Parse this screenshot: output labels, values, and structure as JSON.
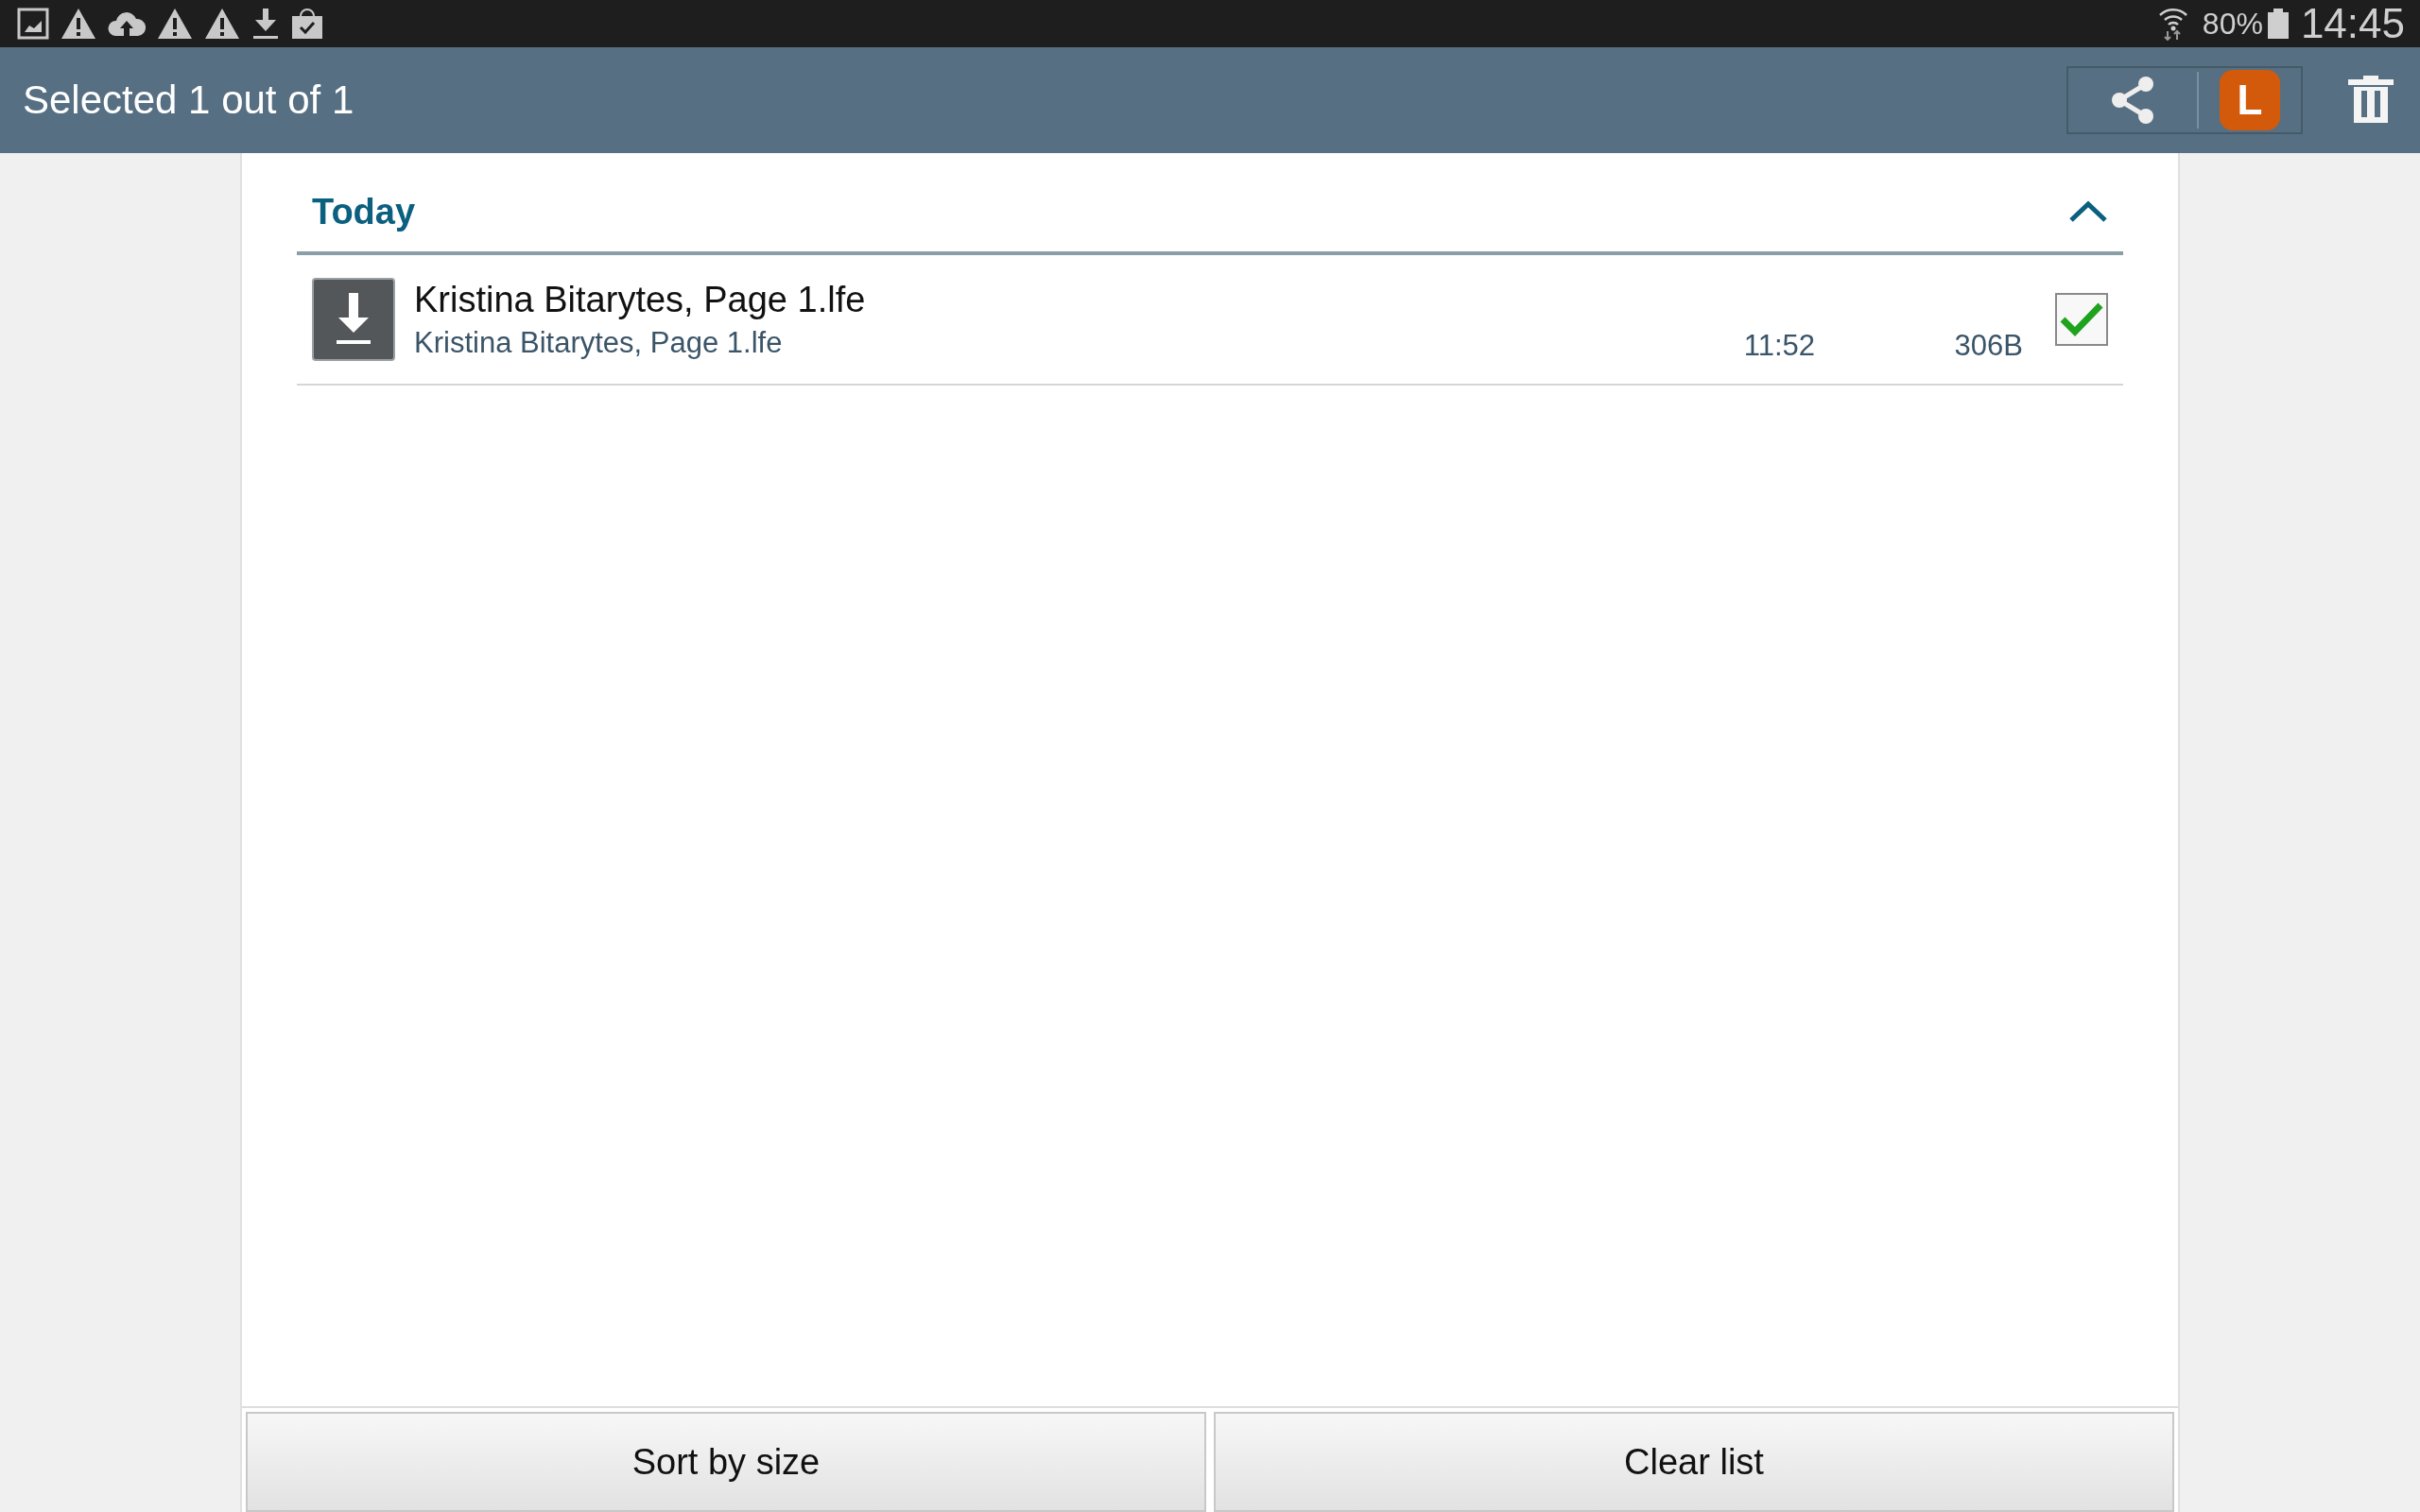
{
  "status_bar": {
    "notifications": [
      {
        "kind": "picture"
      },
      {
        "kind": "warning"
      },
      {
        "kind": "upload"
      },
      {
        "kind": "warning"
      },
      {
        "kind": "warning"
      },
      {
        "kind": "download"
      },
      {
        "kind": "bag"
      }
    ],
    "battery": "80%",
    "time": "14:45"
  },
  "action_bar": {
    "title": "Selected 1 out of 1",
    "app_button": {
      "label": "L"
    }
  },
  "sections": [
    {
      "title": "Today",
      "expanded": true,
      "items": [
        {
          "name": "Kristina Bitarytes, Page 1.lfe",
          "subtitle": "Kristina Bitarytes, Page 1.lfe",
          "time": "11:52",
          "size": "306B",
          "checked": true
        }
      ]
    }
  ],
  "buttons": [
    "Sort by size",
    "Clear list"
  ]
}
